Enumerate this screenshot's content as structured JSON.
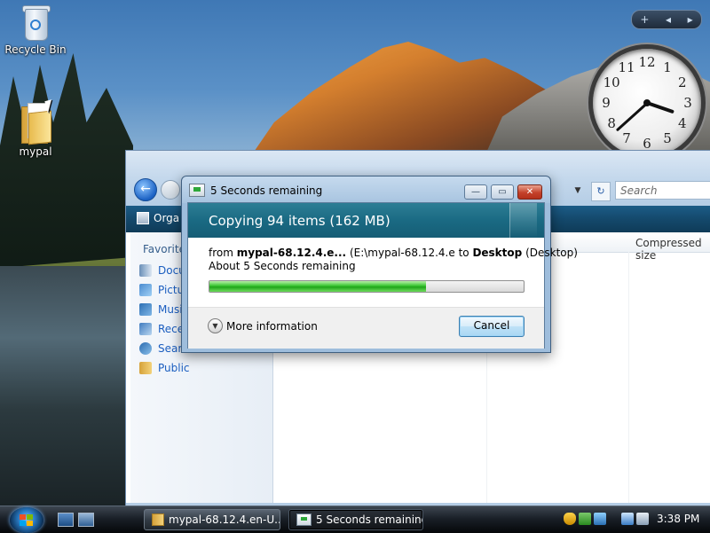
{
  "desktop": {
    "icons": [
      {
        "label": "Recycle Bin",
        "icon": "recycle-bin-icon"
      },
      {
        "label": "mypal",
        "icon": "folder-icon"
      }
    ]
  },
  "sidebar": {
    "controls": {
      "add": "+",
      "prev": "◂",
      "next": "▸"
    },
    "clock": {
      "numbers": [
        "12",
        "1",
        "2",
        "3",
        "4",
        "5",
        "6",
        "7",
        "8",
        "9",
        "10",
        "11"
      ],
      "hour": 3,
      "minute": 38
    }
  },
  "explorer": {
    "search_placeholder": "Search",
    "organize_label": "Orga",
    "favorites_header": "Favorite",
    "nav_items": [
      "Docu",
      "Pictu",
      "Musi",
      "Rece",
      "Searc",
      "Public"
    ],
    "column_header": "Compressed size"
  },
  "dialog": {
    "title": "5 Seconds remaining",
    "heading": "Copying 94 items (162 MB)",
    "from_prefix": "from",
    "from_name": "mypal-68.12.4.e...",
    "from_path": "(E:\\mypal-68.12.4.e",
    "to_word": "to",
    "to_name": "Desktop",
    "to_path": "(Desktop)",
    "remaining": "About 5 Seconds remaining",
    "progress_percent": 69,
    "more_info": "More information",
    "cancel": "Cancel",
    "buttons": {
      "minimize": "—",
      "restore": "▭",
      "close": "✕"
    }
  },
  "taskbar": {
    "buttons": [
      {
        "label": "mypal-68.12.4.en-U...",
        "icon": "folder-icon"
      },
      {
        "label": "5 Seconds remaining",
        "icon": "copy-icon"
      }
    ],
    "time": "3:38 PM"
  },
  "colors": {
    "dialog_header": "#1a6a83",
    "progress": "#37c42f",
    "taskbar": "#1a2028"
  }
}
